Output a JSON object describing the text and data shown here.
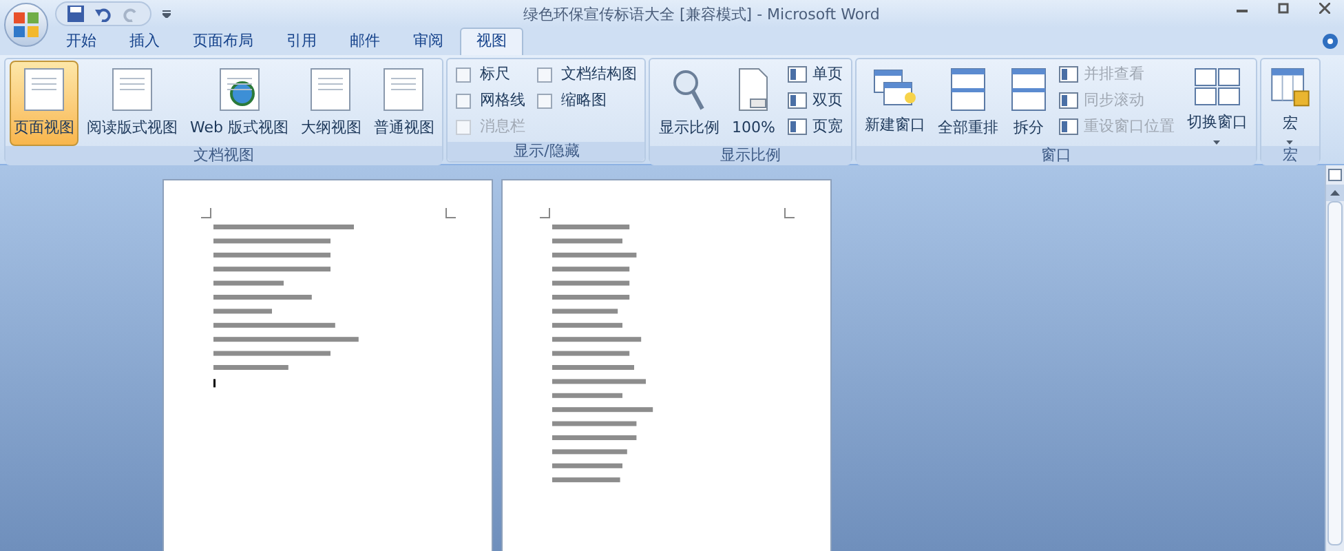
{
  "window": {
    "title": "绿色环保宣传标语大全 [兼容模式] - Microsoft Word"
  },
  "tabs": [
    {
      "label": "开始",
      "selected": false
    },
    {
      "label": "插入",
      "selected": false
    },
    {
      "label": "页面布局",
      "selected": false
    },
    {
      "label": "引用",
      "selected": false
    },
    {
      "label": "邮件",
      "selected": false
    },
    {
      "label": "审阅",
      "selected": false
    },
    {
      "label": "视图",
      "selected": true
    }
  ],
  "ribbon_groups": [
    {
      "label": "文档视图",
      "items": [
        {
          "kind": "large",
          "label": "页面视图",
          "selected": true
        },
        {
          "kind": "large",
          "label": "阅读版式视图",
          "selected": false
        },
        {
          "kind": "large",
          "label": "Web 版式视图",
          "selected": false
        },
        {
          "kind": "large",
          "label": "大纲视图",
          "selected": false
        },
        {
          "kind": "large",
          "label": "普通视图",
          "selected": false
        }
      ]
    },
    {
      "label": "显示/隐藏",
      "items": [
        {
          "kind": "checkbox",
          "label": "标尺",
          "checked": false,
          "disabled": false
        },
        {
          "kind": "checkbox",
          "label": "网格线",
          "checked": false,
          "disabled": false
        },
        {
          "kind": "checkbox",
          "label": "消息栏",
          "checked": false,
          "disabled": true
        },
        {
          "kind": "checkbox",
          "label": "文档结构图",
          "checked": false,
          "disabled": false
        },
        {
          "kind": "checkbox",
          "label": "缩略图",
          "checked": false,
          "disabled": false
        }
      ]
    },
    {
      "label": "显示比例",
      "items": [
        {
          "kind": "large",
          "label": "显示比例",
          "selected": false
        },
        {
          "kind": "large",
          "label": "100%",
          "selected": false
        },
        {
          "kind": "small",
          "label": "单页",
          "disabled": false
        },
        {
          "kind": "small",
          "label": "双页",
          "disabled": false
        },
        {
          "kind": "small",
          "label": "页宽",
          "disabled": false
        }
      ]
    },
    {
      "label": "窗口",
      "items": [
        {
          "kind": "large",
          "label": "新建窗口",
          "selected": false
        },
        {
          "kind": "large",
          "label": "全部重排",
          "selected": false
        },
        {
          "kind": "large",
          "label": "拆分",
          "selected": false
        },
        {
          "kind": "small",
          "label": "并排查看",
          "disabled": true
        },
        {
          "kind": "small",
          "label": "同步滚动",
          "disabled": true
        },
        {
          "kind": "small",
          "label": "重设窗口位置",
          "disabled": true
        },
        {
          "kind": "dropdown",
          "label": "切换窗口",
          "selected": false
        }
      ]
    },
    {
      "label": "宏",
      "items": [
        {
          "kind": "dropdown",
          "label": "宏",
          "selected": false
        }
      ]
    }
  ]
}
